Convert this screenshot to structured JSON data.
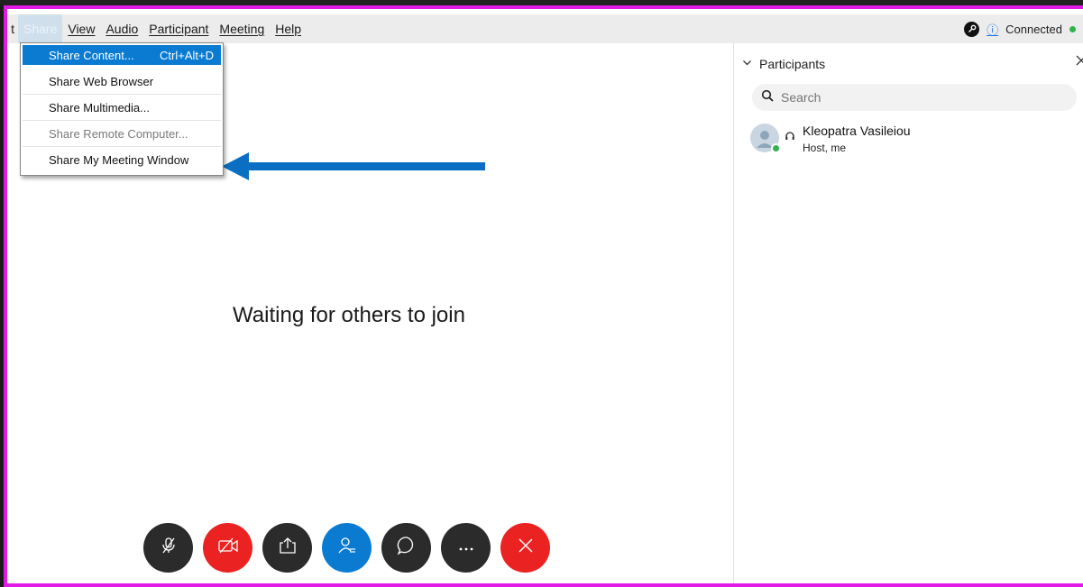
{
  "menubar": {
    "first_fragment": "t",
    "items": [
      {
        "label": "Share",
        "active": true
      },
      {
        "label": "View"
      },
      {
        "label": "Audio"
      },
      {
        "label": "Participant"
      },
      {
        "label": "Meeting"
      },
      {
        "label": "Help"
      }
    ],
    "status_text": "Connected",
    "info_glyph": "ⓘ"
  },
  "share_menu": {
    "items": [
      {
        "label": "Share Content...",
        "shortcut": "Ctrl+Alt+D",
        "selected": true
      },
      {
        "label": "Share Web Browser"
      },
      {
        "label": "Share Multimedia..."
      },
      {
        "label": "Share Remote Computer...",
        "disabled": true
      },
      {
        "label": "Share My Meeting Window"
      }
    ]
  },
  "main": {
    "waiting_text": "Waiting for others to join"
  },
  "participants_panel": {
    "title": "Participants",
    "search_placeholder": "Search",
    "participants": [
      {
        "name": "Kleopatra Vasileiou",
        "role": "Host, me"
      }
    ]
  },
  "controls": [
    {
      "name": "mute-button",
      "icon": "mic-off-icon"
    },
    {
      "name": "video-button",
      "icon": "video-off-icon"
    },
    {
      "name": "share-button",
      "icon": "share-icon"
    },
    {
      "name": "participants-button",
      "icon": "participants-icon"
    },
    {
      "name": "chat-button",
      "icon": "chat-icon"
    },
    {
      "name": "more-button",
      "icon": "more-icon"
    },
    {
      "name": "end-meeting-button",
      "icon": "close-icon"
    }
  ],
  "colors": {
    "window_border": "#e11ae6",
    "accent_blue": "#0a7bd1",
    "danger_red": "#eb2222",
    "dark_button": "#2b2b2b",
    "connected_green": "#2fb34a",
    "annotation_arrow": "#0a6fc2"
  }
}
